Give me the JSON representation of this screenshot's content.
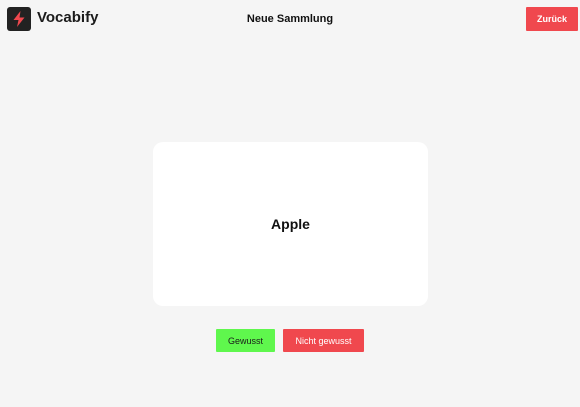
{
  "header": {
    "app_name": "Vocabify",
    "logo_icon": "lightning-icon",
    "title": "Neue Sammlung",
    "back_label": "Zurück"
  },
  "card": {
    "word": "Apple"
  },
  "actions": {
    "known_label": "Gewusst",
    "unknown_label": "Nicht gewusst"
  },
  "colors": {
    "background": "#f5f5f5",
    "accent_red": "#f0484e",
    "accent_green": "#5ff74d",
    "logo_dark": "#222222"
  }
}
